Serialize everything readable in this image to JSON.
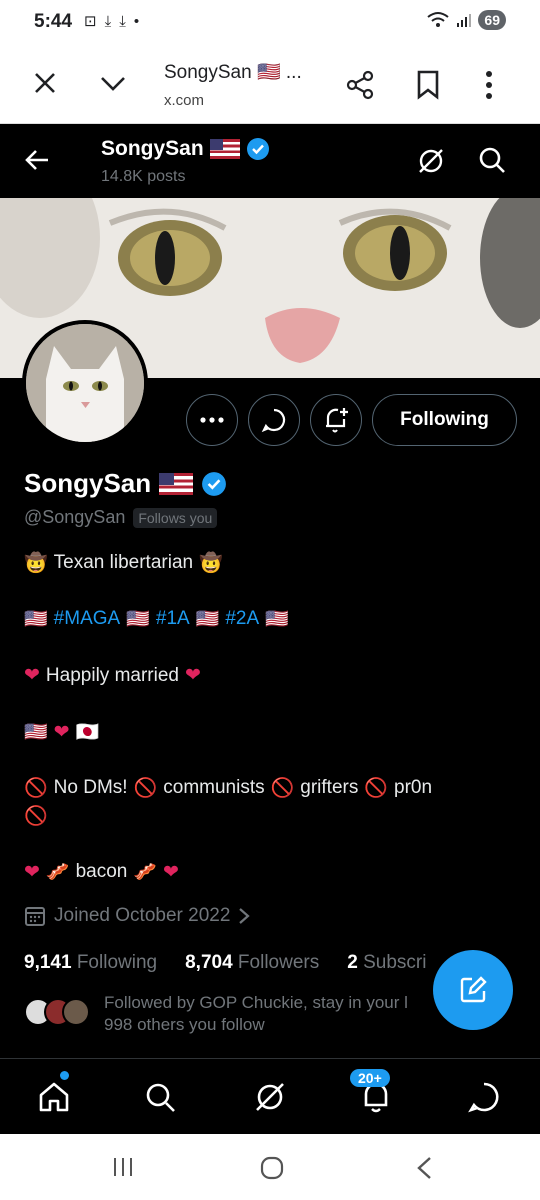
{
  "status": {
    "time": "5:44",
    "battery": "69"
  },
  "browser": {
    "title": "SongySan 🇺🇸 ...",
    "url": "x.com"
  },
  "header": {
    "name": "SongySan",
    "posts": "14.8K posts"
  },
  "profile": {
    "name": "SongySan",
    "handle": "@SongySan",
    "follows_you": "Follows you",
    "following_button": "Following"
  },
  "bio": {
    "line1": "Texan libertarian",
    "tags": [
      "#MAGA",
      "#1A",
      "#2A"
    ],
    "line3": "Happily married",
    "line5_a": "No DMs!",
    "line5_b": "communists",
    "line5_c": "grifters",
    "line5_d": "pr0n",
    "line6": "bacon"
  },
  "joined": "Joined October 2022",
  "stats": {
    "following_count": "9,141",
    "following_label": "Following",
    "followers_count": "8,704",
    "followers_label": "Followers",
    "subs_count": "2",
    "subs_label": "Subscri"
  },
  "followed_by": {
    "line1": "Followed by GOP Chuckie, stay in your l",
    "line2": "998 others you follow"
  },
  "nav": {
    "notif_badge": "20+"
  },
  "colors": {
    "accent": "#1d9bf0",
    "verified": "#1d9bf0",
    "bg": "#000000"
  }
}
